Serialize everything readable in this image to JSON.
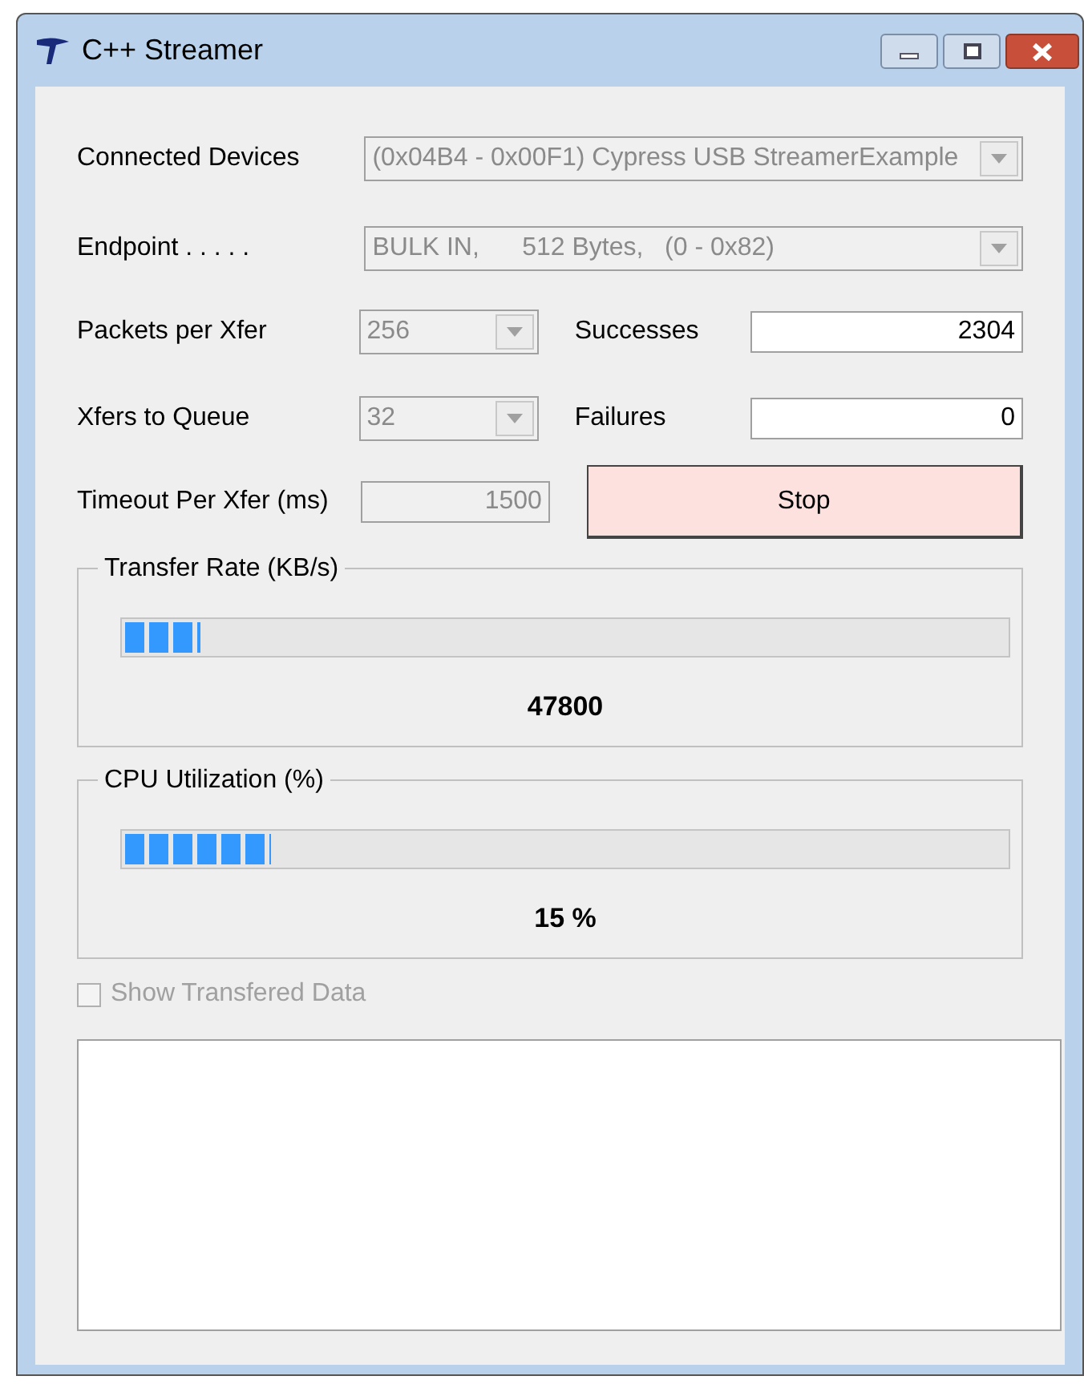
{
  "window": {
    "title": "C++ Streamer",
    "buttons": [
      {
        "kind": "minimize"
      },
      {
        "kind": "maximize"
      },
      {
        "kind": "close"
      }
    ]
  },
  "connected_devices": {
    "label": "Connected Devices",
    "value": "(0x04B4 - 0x00F1) Cypress USB StreamerExample",
    "disabled": true
  },
  "endpoint": {
    "label": "Endpoint . . . . .",
    "value": "BULK IN,      512 Bytes,   (0 - 0x82)",
    "disabled": true
  },
  "packets_per_xfer": {
    "label": "Packets per Xfer",
    "value": "256",
    "disabled": true
  },
  "xfers_to_queue": {
    "label": "Xfers to Queue",
    "value": "32",
    "disabled": true
  },
  "timeout": {
    "label": "Timeout Per Xfer (ms)",
    "value": "1500",
    "disabled": true
  },
  "successes": {
    "label": "Successes",
    "value": "2304"
  },
  "failures": {
    "label": "Failures",
    "value": "0"
  },
  "stop_button": {
    "label": "Stop"
  },
  "transfer_rate": {
    "title": "Transfer Rate (KB/s)",
    "level": 0.085,
    "reading": "47800"
  },
  "cpu_utilization": {
    "title": "CPU Utilization (%)",
    "level": 0.165,
    "reading": "15 %"
  },
  "show_data": {
    "label": "Show Transfered Data",
    "checked": false,
    "disabled": true
  }
}
